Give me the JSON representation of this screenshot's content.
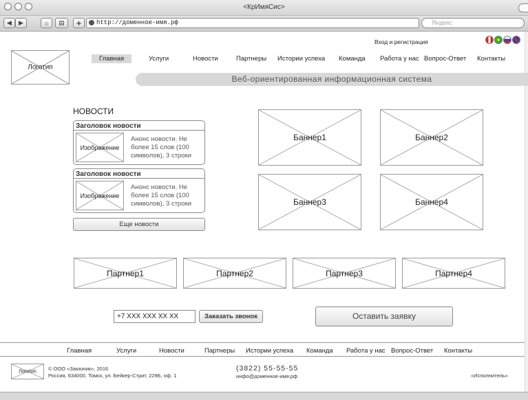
{
  "window": {
    "title": "<КрИмяСис>"
  },
  "browser": {
    "url": "http://доменное-имя.рф",
    "search_placeholder": "Яндекс"
  },
  "header": {
    "logo": "Логотип",
    "login": "Вход и регистрация",
    "nav": [
      "Главная",
      "Услуги",
      "Новости",
      "Партнеры",
      "Истории успеха",
      "Команда",
      "Работа у нас",
      "Вопрос-Ответ",
      "Контакты"
    ],
    "slogan": "Веб-ориентированная информационная система"
  },
  "news": {
    "title": "НОВОСТИ",
    "items": [
      {
        "heading": "Заголовок новости",
        "image": "Изображение",
        "text": [
          "Анонс новости. Не",
          "более 15 слов (100",
          "символов), 3 строки"
        ]
      },
      {
        "heading": "Заголовок новости",
        "image": "Изображение",
        "text": [
          "Анонс новости. Не",
          "более 15 слов (100",
          "символов), 3 строки"
        ]
      }
    ],
    "more_button": "Еще новости"
  },
  "banners": [
    "Баннер1",
    "Баннер2",
    "Баннер3",
    "Баннер4"
  ],
  "partners": [
    "Партнер1",
    "Партнер2",
    "Партнер3",
    "Партнер4"
  ],
  "callback": {
    "phone_value": "+7 XXX XXX XX XX",
    "button": "Заказать звонок",
    "request_button": "Оставить заявку"
  },
  "footer": {
    "nav": [
      "Главная",
      "Услуги",
      "Новости",
      "Партнеры",
      "Истории успеха",
      "Команда",
      "Работа у нас",
      "Вопрос-Ответ",
      "Контакты"
    ],
    "logo": "Логотип",
    "copyright": "© ООО «Заказчик», 2016",
    "address": "Россия, 634000, Томск, ул. Бейкер-Стрит, 229Б, оф. 1",
    "phone": "(3822) 55-55-55",
    "email": "инфо@доменное-имя.рф",
    "executor": "«Исполнитель»"
  },
  "colors": {
    "accent_gray": "#d8d8d8",
    "border": "#8a8a8a"
  }
}
